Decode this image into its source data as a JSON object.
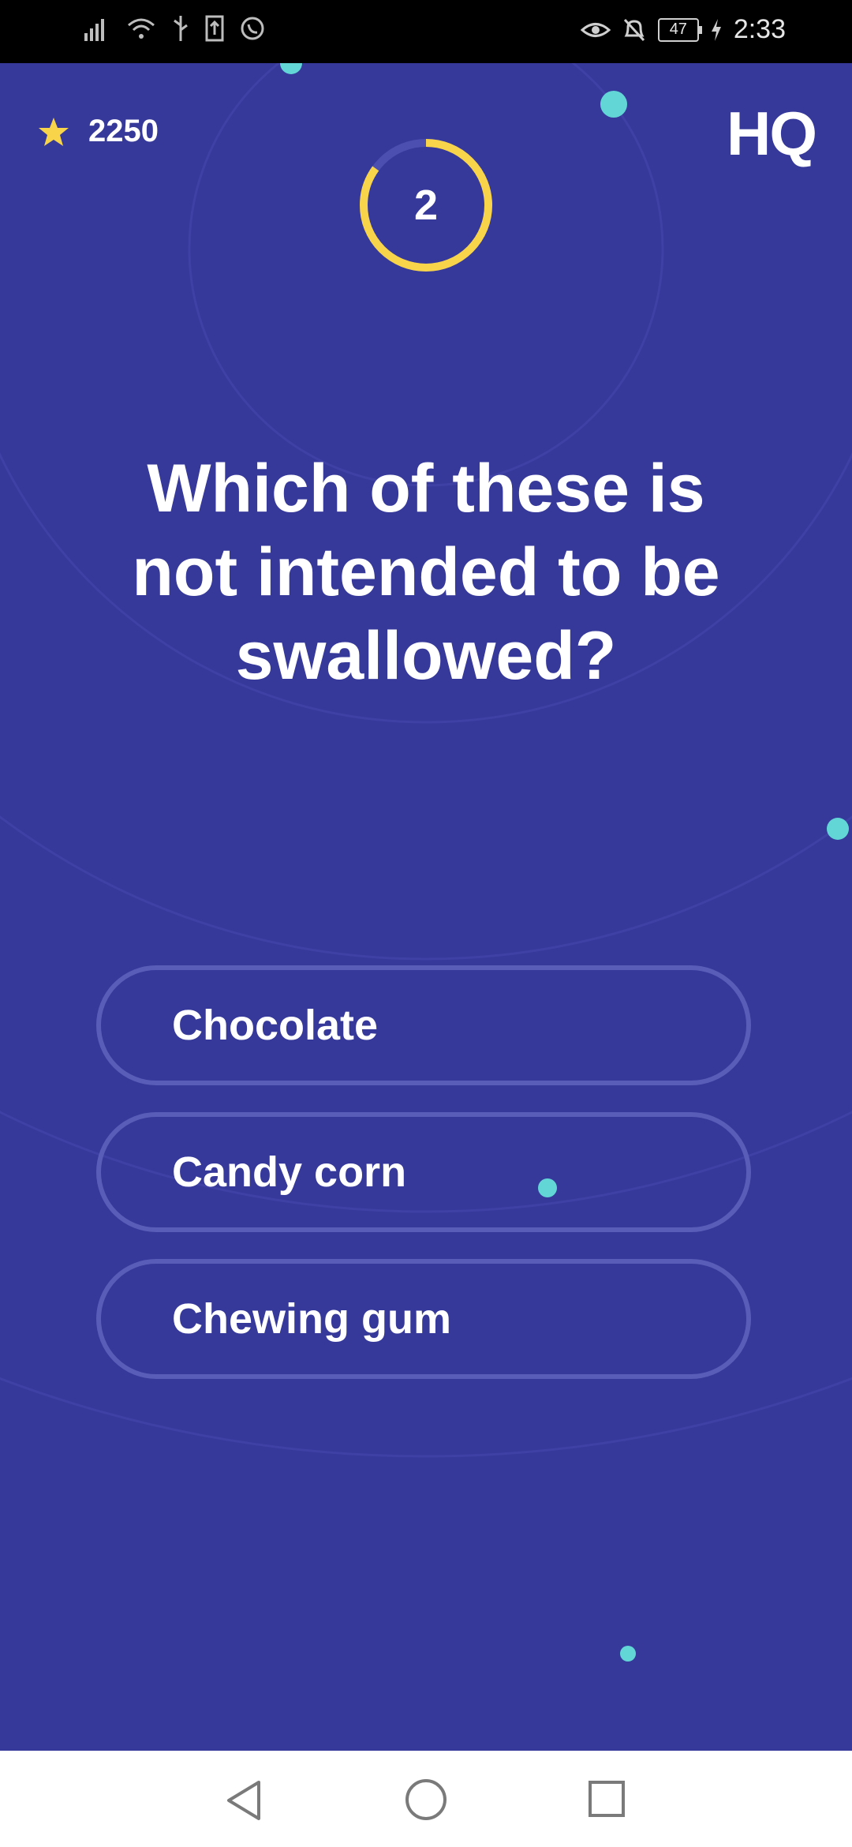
{
  "status_bar": {
    "time": "2:33",
    "battery": "47",
    "left_icons": [
      "signal-icon",
      "wifi-icon",
      "usb-icon",
      "upload-icon",
      "whatsapp-icon"
    ],
    "right_icons": [
      "eye-icon",
      "bell-off-icon",
      "battery-icon",
      "charging-icon"
    ]
  },
  "header": {
    "score": "2250",
    "logo": "HQ",
    "timer_value": "2",
    "timer_progress": 0.85
  },
  "question": {
    "text": "Which of these is not intended to be swallowed?"
  },
  "answers": [
    {
      "label": "Chocolate"
    },
    {
      "label": "Candy corn"
    },
    {
      "label": "Chewing gum"
    }
  ],
  "colors": {
    "background": "#36389a",
    "accent_yellow": "#f8d44a",
    "dot_cyan": "#62d6d6",
    "answer_border": "#5a5db7"
  },
  "nav_bar": {
    "buttons": [
      "back-icon",
      "home-icon",
      "recents-icon"
    ]
  }
}
